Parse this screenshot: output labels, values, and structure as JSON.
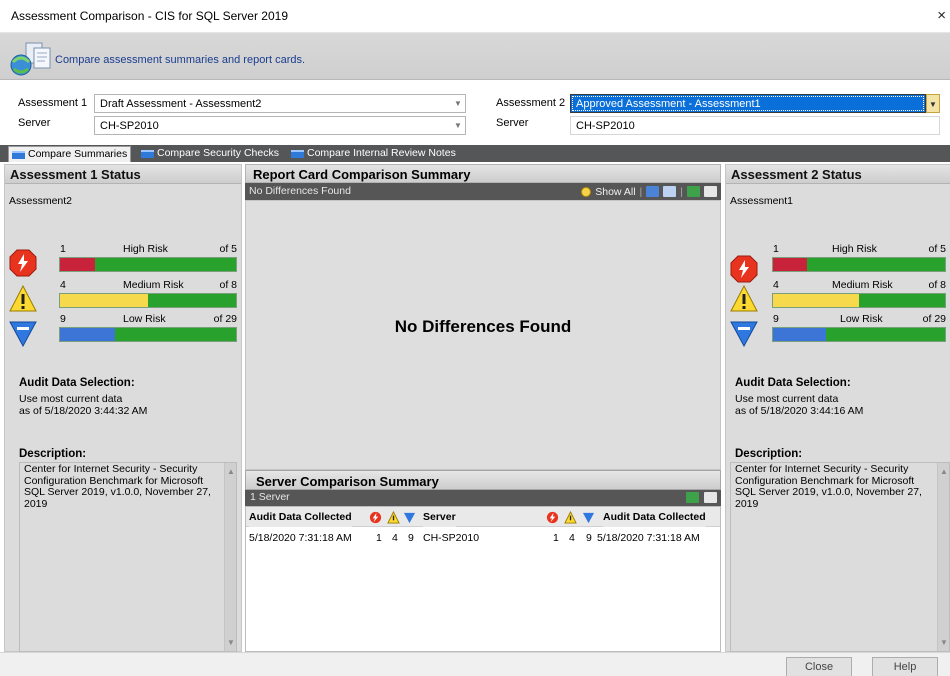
{
  "window": {
    "title": "Assessment Comparison - CIS for SQL Server 2019",
    "close_glyph": "×"
  },
  "banner": {
    "subtitle": "Compare assessment summaries and report cards.",
    "logo_icon": "compare-assessments-icon"
  },
  "selectors": {
    "assessment1_label": "Assessment 1",
    "assessment1_value": "Draft Assessment - Assessment2",
    "server1_label": "Server",
    "server1_value": "CH-SP2010",
    "assessment2_label": "Assessment 2",
    "assessment2_value": "Approved Assessment - Assessment1",
    "server2_label": "Server",
    "server2_value": "CH-SP2010"
  },
  "tabs": [
    {
      "label": "Compare Summaries",
      "selected": true
    },
    {
      "label": "Compare Security Checks",
      "selected": false
    },
    {
      "label": "Compare Internal Review Notes",
      "selected": false
    }
  ],
  "left_panel": {
    "title": "Assessment 1 Status",
    "assessment_name": "Assessment2",
    "risks": [
      {
        "level": "high",
        "count": "1",
        "label": "High Risk",
        "of": "of 5",
        "fraction": 0.2,
        "color": "#c8233b"
      },
      {
        "level": "medium",
        "count": "4",
        "label": "Medium Risk",
        "of": "of 8",
        "fraction": 0.5,
        "color": "#f6d94c"
      },
      {
        "level": "low",
        "count": "9",
        "label": "Low Risk",
        "of": "of 29",
        "fraction": 0.31,
        "color": "#3d75d6"
      }
    ],
    "audit_title": "Audit Data Selection:",
    "audit_line1": "Use most current data",
    "audit_line2": "as of 5/18/2020 3:44:32 AM",
    "desc_title": "Description:",
    "desc_text": "Center for Internet Security - Security Configuration Benchmark for Microsoft SQL Server 2019, v1.0.0, November 27, 2019"
  },
  "right_panel": {
    "title": "Assessment 2 Status",
    "assessment_name": "Assessment1",
    "risks": [
      {
        "level": "high",
        "count": "1",
        "label": "High Risk",
        "of": "of 5",
        "fraction": 0.2,
        "color": "#c8233b"
      },
      {
        "level": "medium",
        "count": "4",
        "label": "Medium Risk",
        "of": "of 8",
        "fraction": 0.5,
        "color": "#f6d94c"
      },
      {
        "level": "low",
        "count": "9",
        "label": "Low Risk",
        "of": "of 29",
        "fraction": 0.31,
        "color": "#3d75d6"
      }
    ],
    "audit_title": "Audit Data Selection:",
    "audit_line1": "Use most current data",
    "audit_line2": "as of 5/18/2020 3:44:16 AM",
    "desc_title": "Description:",
    "desc_text": "Center for Internet Security - Security Configuration Benchmark for Microsoft SQL Server 2019, v1.0.0, November 27, 2019"
  },
  "report_card": {
    "title": "Report Card Comparison Summary",
    "status": "No Differences Found",
    "show_all_label": "Show All",
    "empty_message": "No Differences Found"
  },
  "server_summary": {
    "title": "Server Comparison Summary",
    "count_label": "1 Server",
    "headers": {
      "audit_left": "Audit Data Collected",
      "server": "Server",
      "audit_right": "Audit Data Collected"
    },
    "row": {
      "audit_left": "5/18/2020 7:31:18 AM",
      "high_left": "1",
      "medium_left": "4",
      "low_left": "9",
      "server": "CH-SP2010",
      "high_right": "1",
      "medium_right": "4",
      "low_right": "9",
      "audit_right": "5/18/2020 7:31:18 AM"
    }
  },
  "buttons": {
    "close": "Close",
    "help": "Help"
  }
}
